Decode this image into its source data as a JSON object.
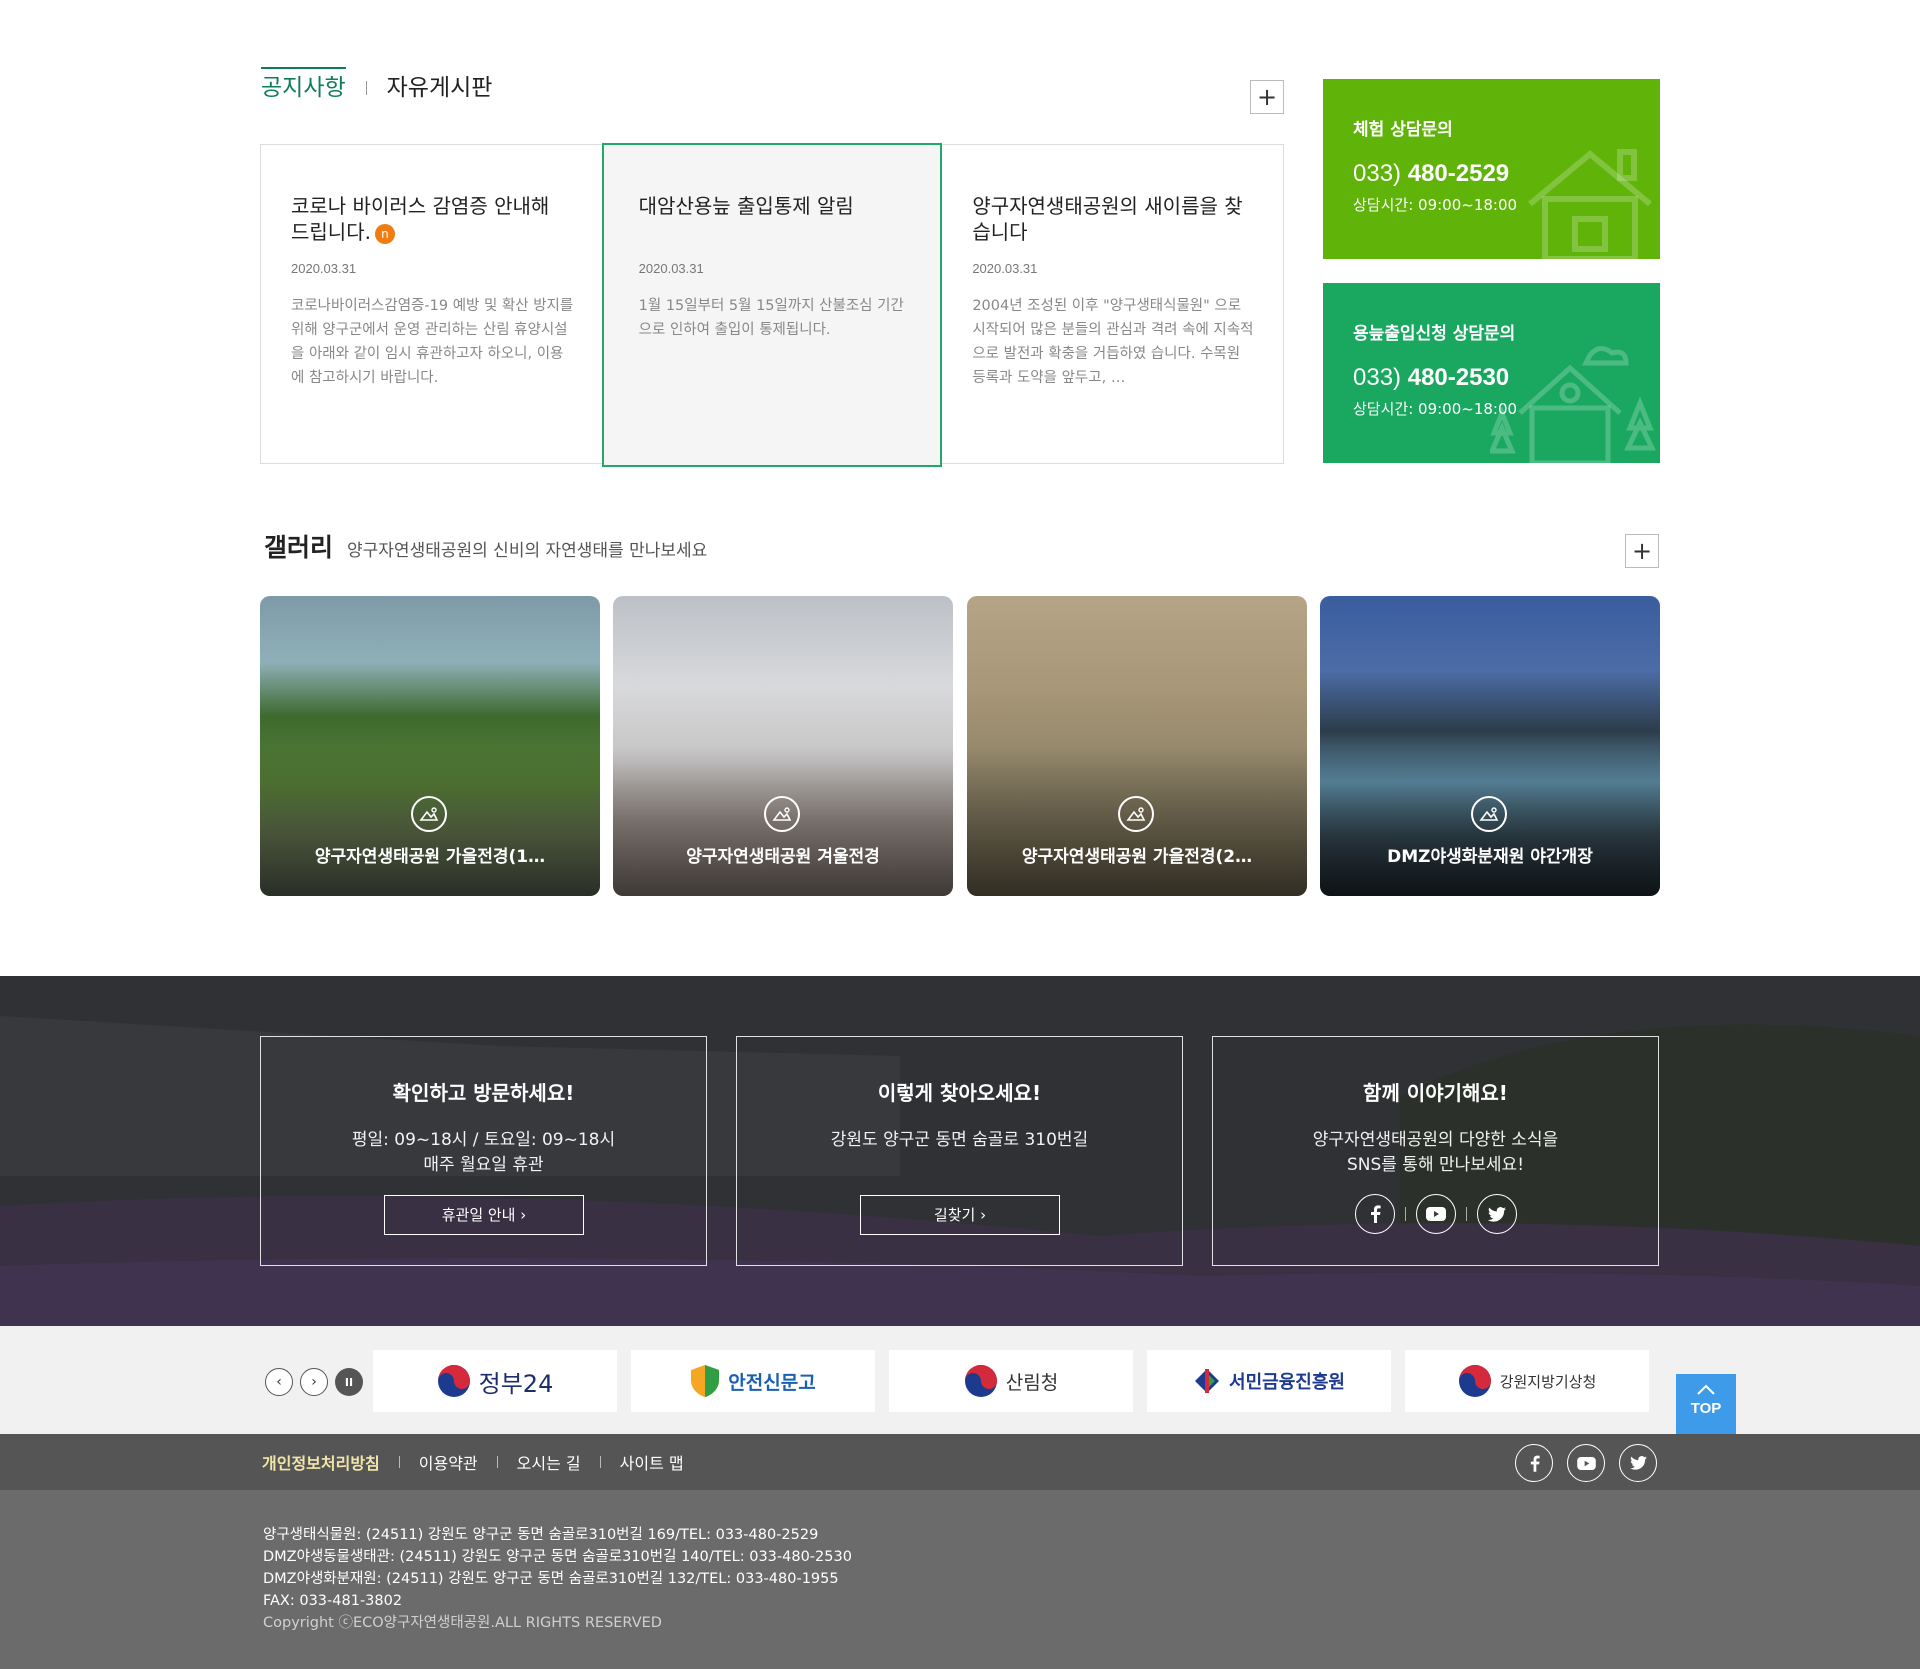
{
  "notice_section": {
    "tabs": [
      "공지사항",
      "자유게시판"
    ],
    "more_label": "+",
    "items": [
      {
        "title": "코로나 바이러스 감염증 안내해 드립니다.",
        "badge": "n",
        "date": "2020.03.31",
        "desc": "코로나바이러스감염증-19 예방 및 확산 방지를 위해 양구군에서 운영 관리하는 산림 휴양시설을 아래와 같이 임시 휴관하고자 하오니, 이용에 참고하시기 바랍니다."
      },
      {
        "title": "대암산용늪 출입통제 알림",
        "badge": "",
        "date": "2020.03.31",
        "desc": "1월 15일부터 5월 15일까지 산불조심 기간으로 인하여 출입이 통제됩니다."
      },
      {
        "title": "양구자연생태공원의 새이름을 찾습니다",
        "badge": "",
        "date": "2020.03.31",
        "desc": "2004년 조성된 이후 \"양구생태식물원\" 으로 시작되어 많은 분들의 관심과 격려 속에 지속적으로 발전과 확충을 거듭하였 습니다. 수목원 등록과 도약을 앞두고, …"
      }
    ]
  },
  "contacts": [
    {
      "title": "체험 상담문의",
      "area": "033)",
      "number": "480-2529",
      "hours": "상담시간: 09:00~18:00",
      "color": "#5fb309"
    },
    {
      "title": "용늪출입신청 상담문의",
      "area": "033)",
      "number": "480-2530",
      "hours": "상담시간: 09:00~18:00",
      "color": "#1aa860"
    }
  ],
  "gallery": {
    "title": "갤러리",
    "subtitle": "양구자연생태공원의 신비의 자연생태를 만나보세요",
    "more_label": "+",
    "items": [
      {
        "caption": "양구자연생태공원 가을전경(1…"
      },
      {
        "caption": "양구자연생태공원 겨울전경"
      },
      {
        "caption": "양구자연생태공원 가을전경(2…"
      },
      {
        "caption": "DMZ야생화분재원 야간개장"
      }
    ]
  },
  "info": [
    {
      "title": "확인하고 방문하세요!",
      "line1": "평일: 09~18시 / 토요일: 09~18시",
      "line2": "매주 월요일 휴관",
      "button": "휴관일 안내 ›"
    },
    {
      "title": "이렇게 찾아오세요!",
      "line1": "강원도 양구군 동면 숨골로 310번길",
      "line2": "",
      "button": "길찾기 ›"
    },
    {
      "title": "함께 이야기해요!",
      "line1": "양구자연생태공원의 다양한 소식을",
      "line2": "SNS를 통해 만나보세요!",
      "button": ""
    }
  ],
  "banners": [
    "정부24",
    "안전신문고",
    "산림청",
    "서민금융진흥원",
    "강원지방기상청"
  ],
  "top_label": "TOP",
  "footer": {
    "links": [
      "개인정보처리방침",
      "이용약관",
      "오시는 길",
      "사이트 맵"
    ],
    "lines": [
      "양구생태식물원: (24511) 강원도 양구군 동면 숨골로310번길 169/TEL: 033-480-2529",
      "DMZ야생동물생태관: (24511) 강원도 양구군 동면 숨골로310번길 140/TEL: 033-480-2530",
      "DMZ야생화분재원: (24511) 강원도 양구군 동면 숨골로310번길 132/TEL: 033-480-1955",
      "FAX: 033-481-3802"
    ],
    "copyright": "Copyright ⓒECO양구자연생태공원.ALL RIGHTS RESERVED"
  }
}
